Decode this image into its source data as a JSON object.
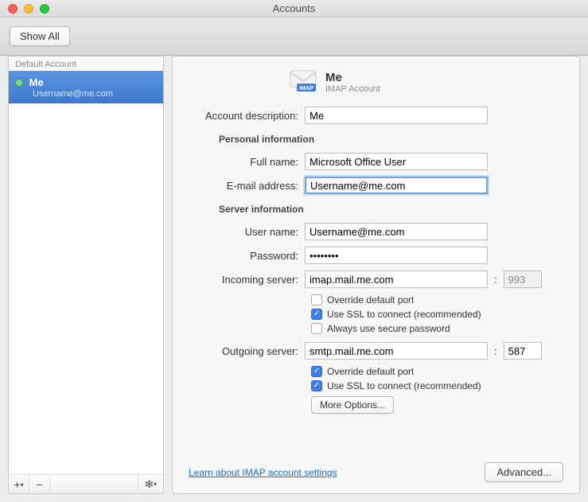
{
  "window_title": "Accounts",
  "toolbar": {
    "show_all": "Show All"
  },
  "sidebar": {
    "header": "Default Account",
    "account": {
      "name": "Me",
      "sub": "Username@me.com"
    },
    "buttons": {
      "add": "+",
      "remove": "−",
      "gear": "✻"
    }
  },
  "detail": {
    "title": "Me",
    "subtitle": "IMAP Account",
    "labels": {
      "account_description": "Account description:",
      "personal_info": "Personal information",
      "full_name": "Full name:",
      "email": "E-mail address:",
      "server_info": "Server information",
      "user_name": "User name:",
      "password": "Password:",
      "incoming": "Incoming server:",
      "outgoing": "Outgoing server:"
    },
    "values": {
      "account_description": "Me",
      "full_name": "Microsoft Office User",
      "email": "Username@me.com",
      "user_name": "Username@me.com",
      "password": "••••••••",
      "incoming": "imap.mail.me.com",
      "incoming_port": "993",
      "outgoing": "smtp.mail.me.com",
      "outgoing_port": "587"
    },
    "checks": {
      "in_override": "Override default port",
      "in_ssl": "Use SSL to connect (recommended)",
      "in_secure": "Always use secure password",
      "out_override": "Override default port",
      "out_ssl": "Use SSL to connect (recommended)"
    },
    "more_options": "More Options...",
    "learn_link": "Learn about IMAP account settings",
    "advanced": "Advanced..."
  }
}
